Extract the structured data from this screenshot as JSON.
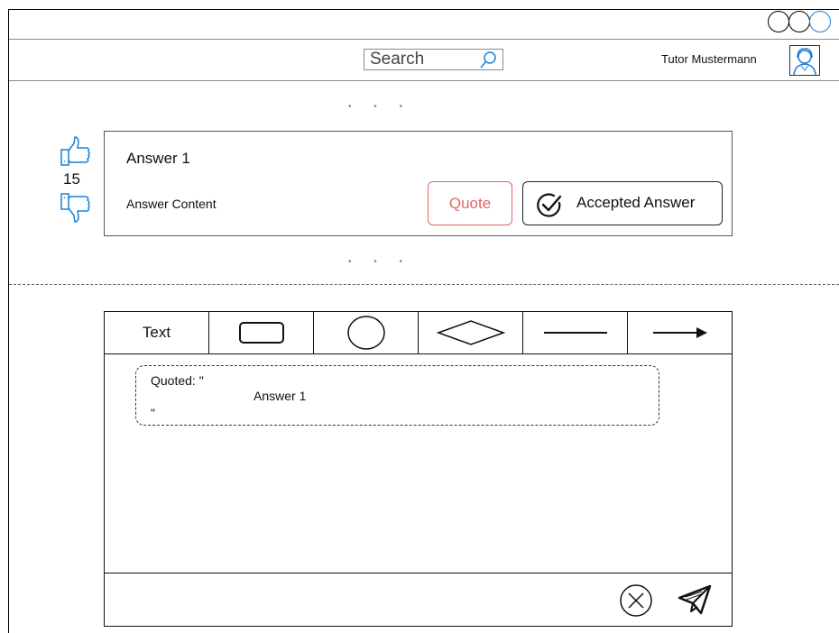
{
  "header": {
    "search": {
      "placeholder": "Search"
    },
    "user_name": "Tutor Mustermann"
  },
  "ellipsis": "• • •",
  "answer": {
    "votes": "15",
    "title": "Answer 1",
    "content": "Answer Content",
    "quote_label": "Quote",
    "accepted_label": "Accepted Answer"
  },
  "editor": {
    "tools": [
      {
        "label": "Text"
      },
      {
        "icon": "rectangle-icon"
      },
      {
        "icon": "circle-icon"
      },
      {
        "icon": "diamond-icon"
      },
      {
        "icon": "line-icon"
      },
      {
        "icon": "arrow-icon"
      }
    ],
    "quote_prefix": "Quoted: \"",
    "quote_answer": "Answer 1",
    "quote_suffix": "\""
  },
  "colors": {
    "quote_accent": "#e06666",
    "window_control_accent": "#1a7fd4",
    "avatar_accent": "#1a7fd4"
  }
}
